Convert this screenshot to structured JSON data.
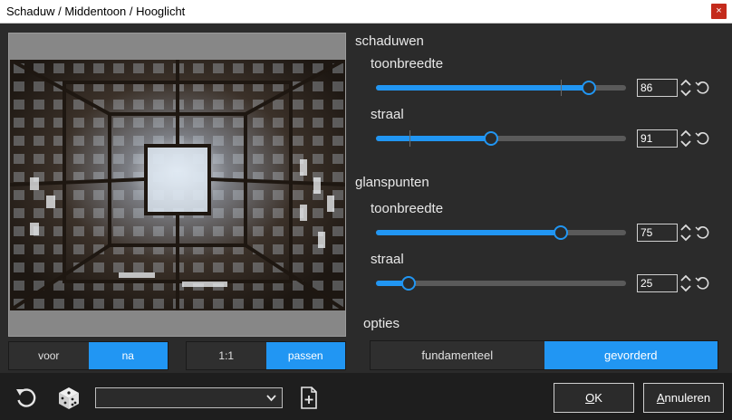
{
  "window": {
    "title": "Schaduw / Middentoon / Hooglicht",
    "close": "×"
  },
  "preview": {
    "compare": [
      {
        "label": "voor",
        "active": false
      },
      {
        "label": "na",
        "active": true
      }
    ],
    "zoom": [
      {
        "label": "1:1",
        "active": false
      },
      {
        "label": "passen",
        "active": true
      }
    ]
  },
  "shadows": {
    "title": "schaduwen",
    "width_label": "toonbreedte",
    "width_value": "86",
    "width_level": 0.85,
    "radius_label": "straal",
    "radius_value": "91",
    "radius_level": 0.46
  },
  "highlights": {
    "title": "glanspunten",
    "width_label": "toonbreedte",
    "width_value": "75",
    "width_level": 0.74,
    "radius_label": "straal",
    "radius_value": "25",
    "radius_level": 0.13
  },
  "options": {
    "title": "opties",
    "modes": [
      {
        "label": "fundamenteel",
        "active": false
      },
      {
        "label": "gevorderd",
        "active": true
      }
    ]
  },
  "footer": {
    "preset_value": "",
    "ok_first": "O",
    "ok_rest": "K",
    "cancel_first": "A",
    "cancel_rest": "nnuleren"
  },
  "colors": {
    "accent": "#2196f3",
    "background": "#2b2b2b",
    "footer": "#1e1e1e"
  }
}
